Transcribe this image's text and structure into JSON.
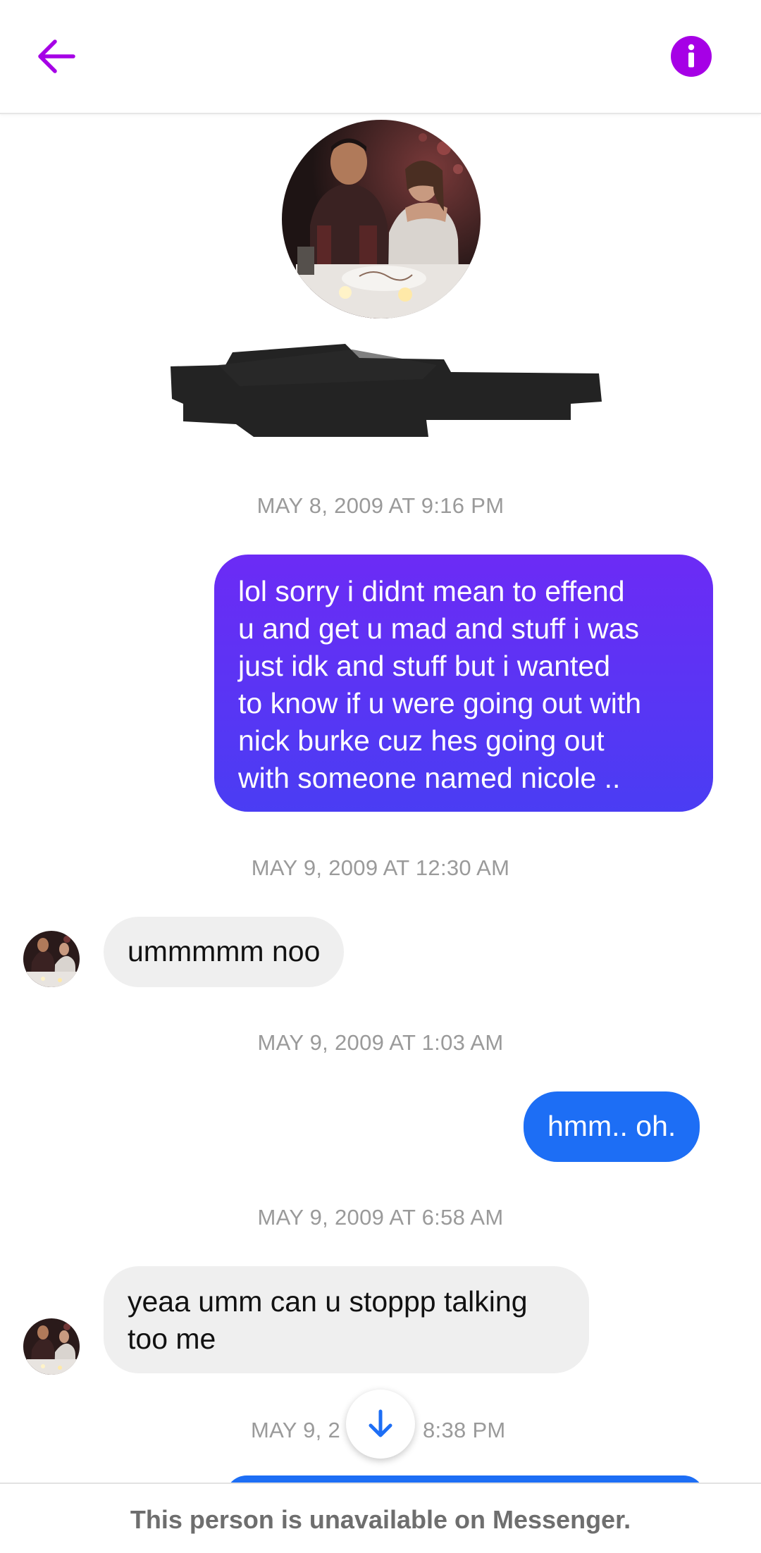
{
  "colors": {
    "accent": "#a600e6",
    "outgoing_gradient_top": "#6c2bf5",
    "outgoing_gradient_bottom": "#4a3df3",
    "outgoing_solid": "#1d6ef5",
    "incoming_bubble": "#efefef",
    "timestamp": "#9a9a9a"
  },
  "header": {
    "back_icon": "arrow-left-icon",
    "info_icon": "info-icon"
  },
  "profile": {
    "photo": "profile-photo",
    "name_redacted": true
  },
  "thread": {
    "ts1": "MAY 8, 2009 AT 9:16 PM",
    "msg1": "lol sorry i didnt mean to effend\nu and get u mad and stuff i was\njust idk and stuff but i wanted\nto know if u were going out with\nnick burke cuz hes going out\nwith someone named nicole ..",
    "ts2": "MAY 9, 2009 AT 12:30 AM",
    "msg2": "ummmmm noo",
    "ts3": "MAY 9, 2009 AT 1:03 AM",
    "msg3": "hmm.. oh.",
    "ts4": "MAY 9, 2009 AT 6:58 AM",
    "msg4": "yeaa umm can u stoppp talking\ntoo me",
    "ts5_left": "MAY 9, 2",
    "ts5_right": "8:38 PM"
  },
  "scroll_button": {
    "icon": "arrow-down-icon"
  },
  "footer": {
    "status": "This person is unavailable on Messenger."
  }
}
